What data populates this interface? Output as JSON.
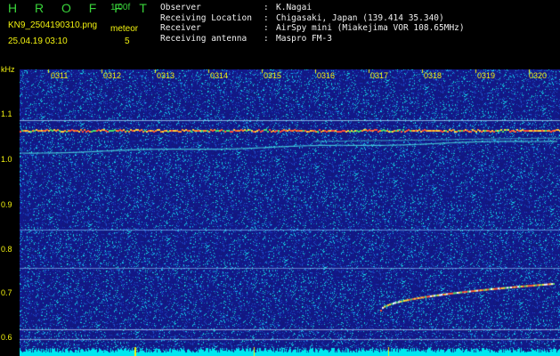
{
  "header": {
    "app_title": "H R O F F T",
    "version": "1.00f",
    "file_name": "KN9_2504190310.png",
    "meteor_label": "meteor",
    "timestamp": "25.04.19 03:10",
    "meteor_count": "5",
    "info": [
      {
        "key": "Observer",
        "value": "K.Nagai"
      },
      {
        "key": "Receiving Location",
        "value": "Chigasaki, Japan (139.414 35.340)"
      },
      {
        "key": "Receiver",
        "value": "AirSpy mini (Miakejima VOR 108.65MHz)"
      },
      {
        "key": "Receiving antenna",
        "value": "Maspro FM-3"
      }
    ]
  },
  "axis": {
    "unit": "kHz",
    "y_ticks": [
      "1.1",
      "1.0",
      "0.9",
      "0.8",
      "0.7",
      "0.6"
    ],
    "x_ticks": [
      "0311",
      "0312",
      "0313",
      "0314",
      "0315",
      "0316",
      "0317",
      "0318",
      "0319",
      "0320"
    ]
  },
  "colors": {
    "background": "#000000",
    "label": "#f2f20f",
    "title": "#39d33a",
    "spectrogram": "#1b1f8a",
    "baseline": "#00e8f0"
  }
}
